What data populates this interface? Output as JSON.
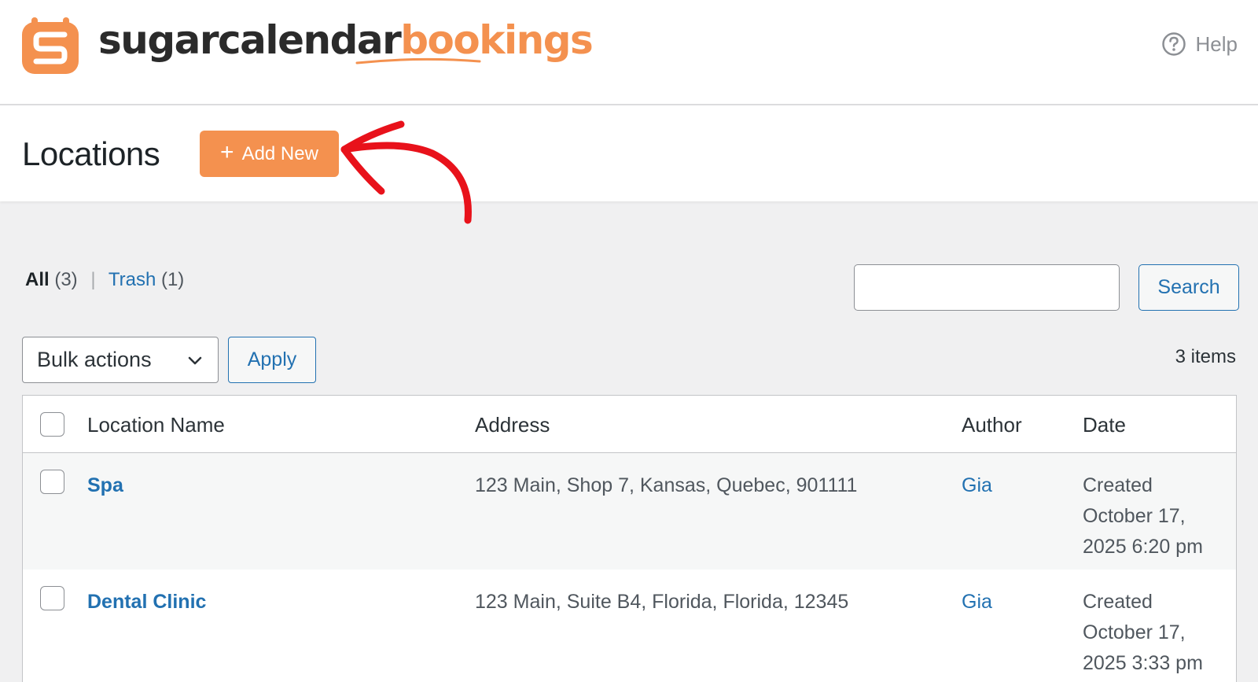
{
  "brand": {
    "name_dark": "sugarcalendar",
    "name_accent": "bookings",
    "accent_color": "#f4914f"
  },
  "help": {
    "label": "Help",
    "icon": "question-circle-icon"
  },
  "header": {
    "title": "Locations",
    "add_new_label": "Add New"
  },
  "filters": {
    "all_label": "All",
    "all_count": "(3)",
    "separator": "|",
    "trash_label": "Trash",
    "trash_count": "(1)"
  },
  "search": {
    "placeholder": "",
    "button_label": "Search"
  },
  "bulk": {
    "selected": "Bulk actions",
    "apply_label": "Apply"
  },
  "items_count": "3 items",
  "table": {
    "columns": [
      "Location Name",
      "Address",
      "Author",
      "Date"
    ],
    "rows": [
      {
        "name": "Spa",
        "address": "123 Main, Shop 7, Kansas, Quebec, 901111",
        "author": "Gia",
        "date_line1": "Created",
        "date_line2": "October 17,",
        "date_line3": "2025 6:20 pm"
      },
      {
        "name": "Dental Clinic",
        "address": "123 Main, Suite B4, Florida, Florida, 12345",
        "author": "Gia",
        "date_line1": "Created",
        "date_line2": "October 17,",
        "date_line3": "2025 3:33 pm"
      }
    ]
  },
  "annotation": {
    "arrow_color": "#e8121b"
  }
}
